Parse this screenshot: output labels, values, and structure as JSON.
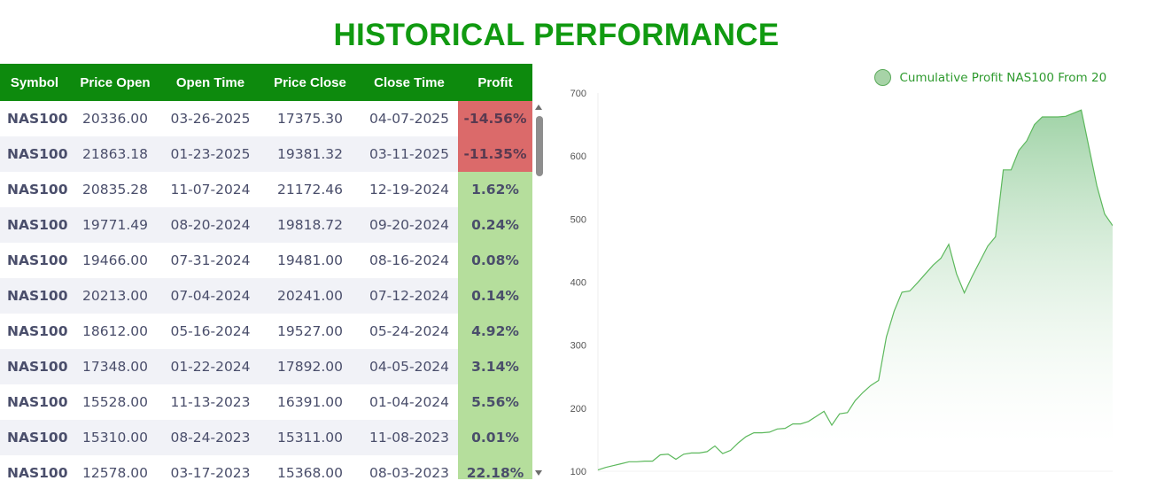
{
  "title": "HISTORICAL PERFORMANCE",
  "table": {
    "headers": [
      "Symbol",
      "Price Open",
      "Open Time",
      "Price Close",
      "Close Time",
      "Profit"
    ],
    "rows": [
      {
        "symbol": "NAS100",
        "price_open": "20336.00",
        "open_time": "03-26-2025",
        "price_close": "17375.30",
        "close_time": "04-07-2025",
        "profit": "-14.56%",
        "sign": "neg"
      },
      {
        "symbol": "NAS100",
        "price_open": "21863.18",
        "open_time": "01-23-2025",
        "price_close": "19381.32",
        "close_time": "03-11-2025",
        "profit": "-11.35%",
        "sign": "neg"
      },
      {
        "symbol": "NAS100",
        "price_open": "20835.28",
        "open_time": "11-07-2024",
        "price_close": "21172.46",
        "close_time": "12-19-2024",
        "profit": "1.62%",
        "sign": "pos"
      },
      {
        "symbol": "NAS100",
        "price_open": "19771.49",
        "open_time": "08-20-2024",
        "price_close": "19818.72",
        "close_time": "09-20-2024",
        "profit": "0.24%",
        "sign": "pos"
      },
      {
        "symbol": "NAS100",
        "price_open": "19466.00",
        "open_time": "07-31-2024",
        "price_close": "19481.00",
        "close_time": "08-16-2024",
        "profit": "0.08%",
        "sign": "pos"
      },
      {
        "symbol": "NAS100",
        "price_open": "20213.00",
        "open_time": "07-04-2024",
        "price_close": "20241.00",
        "close_time": "07-12-2024",
        "profit": "0.14%",
        "sign": "pos"
      },
      {
        "symbol": "NAS100",
        "price_open": "18612.00",
        "open_time": "05-16-2024",
        "price_close": "19527.00",
        "close_time": "05-24-2024",
        "profit": "4.92%",
        "sign": "pos"
      },
      {
        "symbol": "NAS100",
        "price_open": "17348.00",
        "open_time": "01-22-2024",
        "price_close": "17892.00",
        "close_time": "04-05-2024",
        "profit": "3.14%",
        "sign": "pos"
      },
      {
        "symbol": "NAS100",
        "price_open": "15528.00",
        "open_time": "11-13-2023",
        "price_close": "16391.00",
        "close_time": "01-04-2024",
        "profit": "5.56%",
        "sign": "pos"
      },
      {
        "symbol": "NAS100",
        "price_open": "15310.00",
        "open_time": "08-24-2023",
        "price_close": "15311.00",
        "close_time": "11-08-2023",
        "profit": "0.01%",
        "sign": "pos"
      },
      {
        "symbol": "NAS100",
        "price_open": "12578.00",
        "open_time": "03-17-2023",
        "price_close": "15368.00",
        "close_time": "08-03-2023",
        "profit": "22.18%",
        "sign": "pos"
      }
    ]
  },
  "colors": {
    "title": "#119a11",
    "header_bg": "#0d8a0d",
    "loss_bg": "#db6a6a",
    "gain_bg": "#b5de9c",
    "line": "#5cb85c",
    "fill": "#8fcb97"
  },
  "scrollbar_icons": [
    "scroll-up-arrow-icon",
    "scroll-down-arrow-icon"
  ],
  "chart_data": {
    "type": "area",
    "title": "",
    "xlabel": "",
    "ylabel": "",
    "legend": {
      "label": "Cumulative Profit NAS100 From 20",
      "position": "top-right"
    },
    "ylim": [
      100,
      700
    ],
    "yticks": [
      "100",
      "200",
      "300",
      "400",
      "500",
      "600",
      "700"
    ],
    "grid": false,
    "series": [
      {
        "name": "Cumulative Profit NAS100 From 20",
        "x": [
          0,
          1,
          2,
          3,
          4,
          5,
          6,
          7,
          8,
          9,
          10,
          11,
          12,
          13,
          14,
          15,
          16,
          17,
          18,
          19,
          20,
          21,
          22,
          23,
          24,
          25,
          26,
          27,
          28,
          29,
          30,
          31,
          32,
          33,
          34,
          35,
          36,
          37,
          38,
          39,
          40,
          41,
          42,
          43,
          44,
          45,
          46,
          47,
          48,
          49,
          50,
          51,
          52,
          53,
          54,
          55,
          56,
          57,
          58,
          59,
          60,
          61,
          62,
          63,
          64,
          65,
          66,
          67,
          68
        ],
        "values": [
          102,
          106,
          109,
          112,
          115,
          115,
          116,
          116,
          126,
          127,
          119,
          127,
          129,
          129,
          131,
          140,
          128,
          133,
          145,
          155,
          161,
          161,
          162,
          167,
          168,
          175,
          175,
          179,
          187,
          195,
          173,
          191,
          193,
          212,
          225,
          236,
          244,
          313,
          354,
          384,
          386,
          399,
          413,
          427,
          438,
          460,
          413,
          383,
          409,
          433,
          457,
          472,
          578,
          578,
          609,
          624,
          650,
          662,
          662,
          662,
          663,
          668,
          673,
          613,
          553,
          508,
          490,
          480,
          470
        ],
        "points_visible": 66
      }
    ]
  }
}
